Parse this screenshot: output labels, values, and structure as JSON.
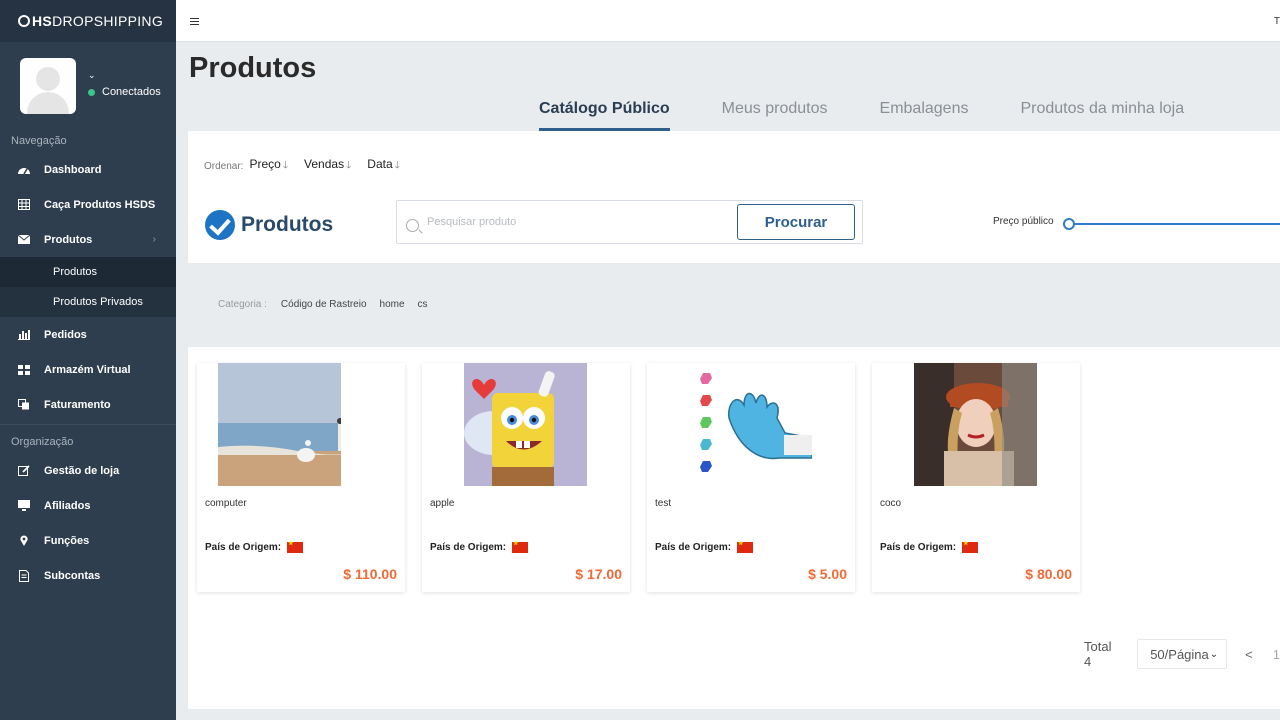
{
  "app": {
    "logo_prefix": "HS",
    "logo_suffix": "DROPSHIPPING"
  },
  "user": {
    "status": "Conectados"
  },
  "sidebar": {
    "section_nav": "Navegação",
    "section_org": "Organização",
    "items": {
      "dashboard": "Dashboard",
      "caca": "Caça Produtos HSDS",
      "produtos": "Produtos",
      "produtos_sub": "Produtos",
      "produtos_privados": "Produtos Privados",
      "pedidos": "Pedidos",
      "armazem": "Armazém Virtual",
      "faturamento": "Faturamento",
      "gestao": "Gestão de loja",
      "afiliados": "Afiliados",
      "funcoes": "Funções",
      "subcontas": "Subcontas"
    }
  },
  "topbar": {
    "truncated_text": "T"
  },
  "page": {
    "title": "Produtos"
  },
  "tabs": [
    "Catálogo Público",
    "Meus produtos",
    "Embalagens",
    "Produtos da minha loja"
  ],
  "sort": {
    "label": "Ordenar:",
    "options": [
      "Preço",
      "Vendas",
      "Data"
    ]
  },
  "search": {
    "brand": "Produtos",
    "placeholder": "Pesquisar produto",
    "button": "Procurar",
    "price_label": "Preço público"
  },
  "categories": {
    "label": "Categoria :",
    "items": [
      "Código de Rastreio",
      "home",
      "cs"
    ]
  },
  "products": [
    {
      "name": "computer",
      "origin_label": "País de Origem:",
      "price": "$ 110.00"
    },
    {
      "name": "apple",
      "origin_label": "País de Origem:",
      "price": "$ 17.00"
    },
    {
      "name": "test",
      "origin_label": "País de Origem:",
      "price": "$ 5.00"
    },
    {
      "name": "coco",
      "origin_label": "País de Origem:",
      "price": "$ 80.00"
    }
  ],
  "pagination": {
    "total": "Total 4",
    "page_size": "50/Página",
    "prev": "<",
    "next": "1"
  },
  "colors": {
    "sidebar": "#2f3e4e",
    "accent": "#2e5f8d",
    "price": "#f06a35"
  }
}
